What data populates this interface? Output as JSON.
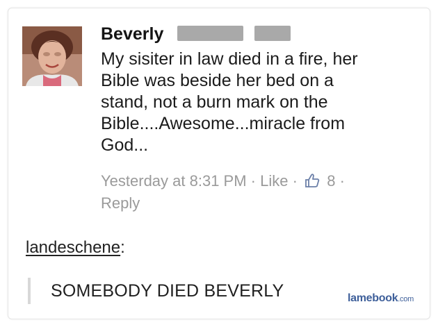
{
  "comment": {
    "author_name": "Beverly",
    "text": "My sisiter in law died in a fire, her\nBible was beside her bed on a\nstand, not a burn mark on the\nBible....Awesome...miracle from\nGod...",
    "timestamp": "Yesterday at 8:31 PM",
    "separator": "·",
    "like_label": "Like",
    "like_count": "8",
    "reply_label": "Reply"
  },
  "tumblr": {
    "username": "landeschene",
    "username_suffix": ":",
    "quote": "SOMEBODY DIED BEVERLY"
  },
  "watermark": {
    "brand": "lamebook",
    "domain": ".com"
  },
  "colors": {
    "meta_gray": "#9a9a9a",
    "watermark_blue": "#3e5f9a"
  }
}
